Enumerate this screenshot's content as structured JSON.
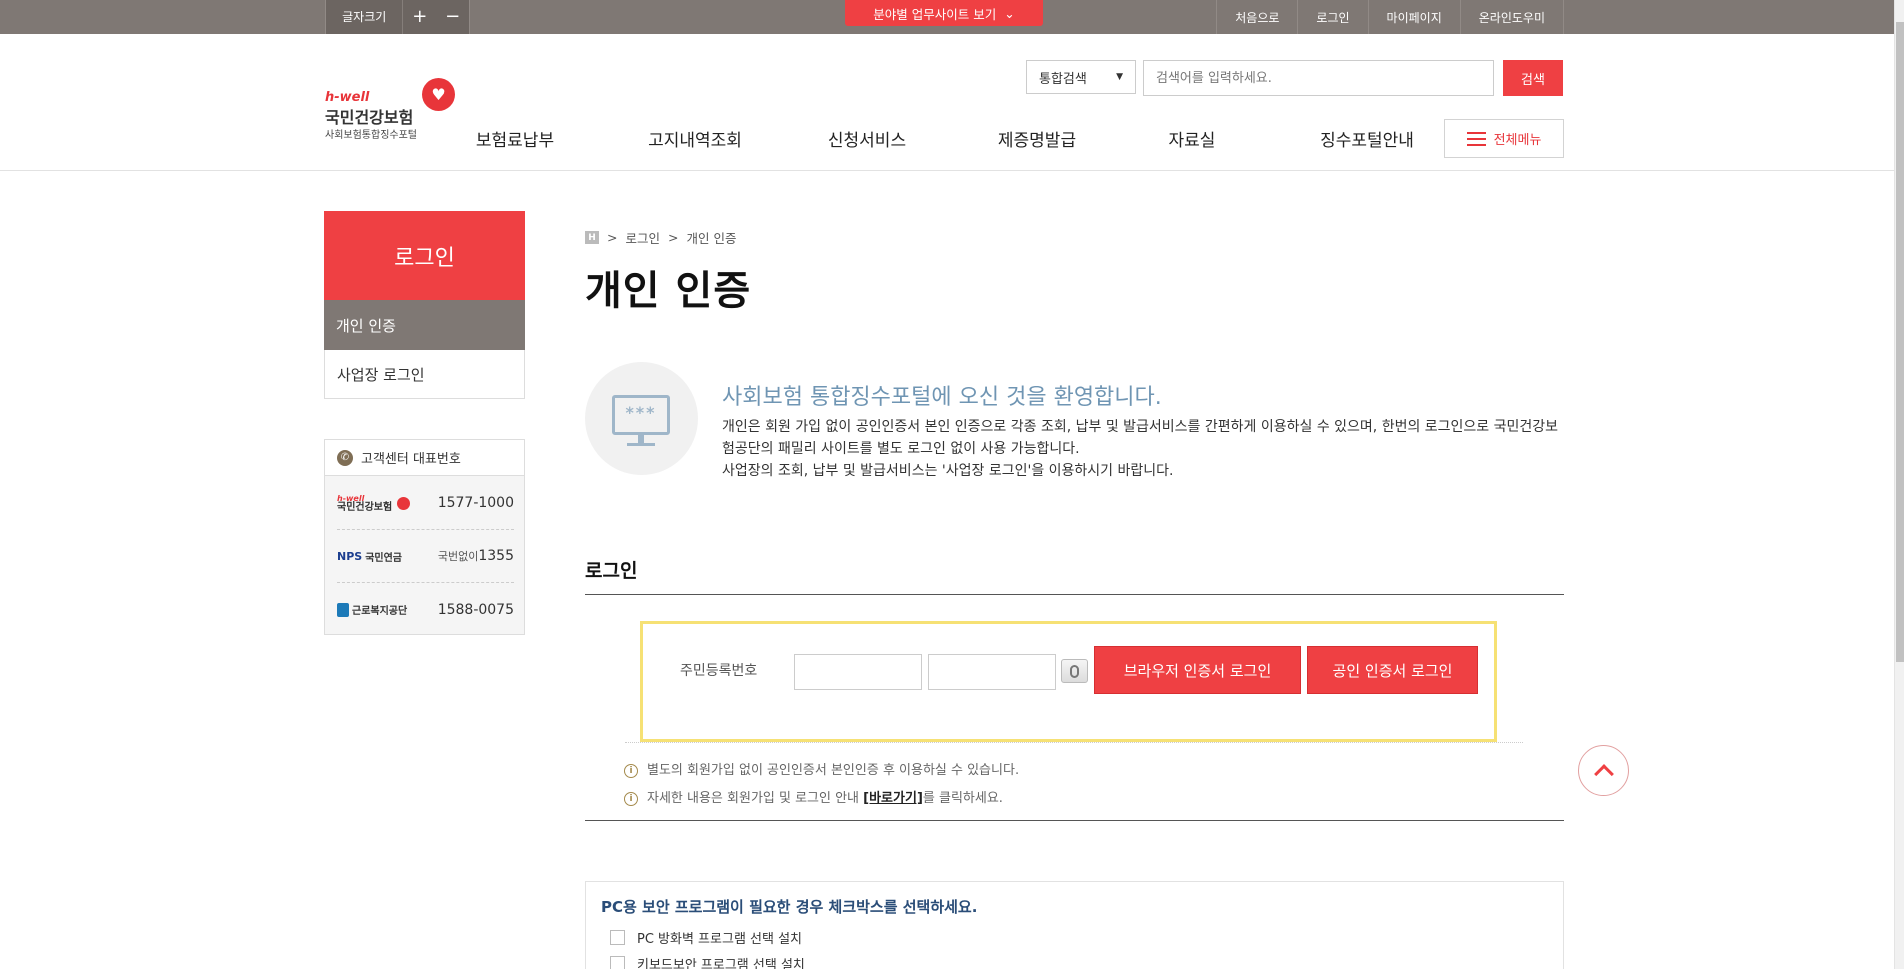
{
  "topbar": {
    "font_size_label": "글자크기",
    "font_plus": "+",
    "font_minus": "−",
    "field_site_label": "분야별 업무사이트 보기",
    "field_site_icon": "chevron-down-icon",
    "links": [
      "처음으로",
      "로그인",
      "마이페이지",
      "온라인도우미"
    ]
  },
  "header": {
    "logo": {
      "hwell": "h-well",
      "name": "국민건강보험",
      "sub": "사회보험통합징수포털"
    },
    "search": {
      "select_value": "통합검색",
      "placeholder": "검색어를 입력하세요.",
      "button": "검색"
    },
    "gnb": [
      "보험료납부",
      "고지내역조회",
      "신청서비스",
      "제증명발급",
      "자료실",
      "징수포털안내"
    ],
    "all_menu": "전체메뉴"
  },
  "sidebar": {
    "title": "로그인",
    "items": [
      {
        "label": "개인 인증",
        "active": true
      },
      {
        "label": "사업장 로그인",
        "active": false
      }
    ],
    "customer_center": {
      "title": "고객센터 대표번호",
      "rows": [
        {
          "org": "국민건강보험",
          "org_tag": "h-well",
          "number": "1577-1000",
          "prefix": ""
        },
        {
          "org": "국민연금",
          "org_tag": "NPS",
          "number": "1355",
          "prefix": "국번없이"
        },
        {
          "org": "근로복지공단",
          "org_tag": "",
          "number": "1588-0075",
          "prefix": ""
        }
      ]
    }
  },
  "main": {
    "breadcrumb": [
      "H",
      ">",
      "로그인",
      ">",
      "개인 인증"
    ],
    "title": "개인 인증",
    "welcome": {
      "title": "사회보험 통합징수포털에 오신 것을 환영합니다.",
      "icon_text": "***",
      "desc_1": "개인은 회원 가입 없이 공인인증서 본인 인증으로 각종 조회, 납부 및 발급서비스를 간편하게 이용하실 수 있으며, 한번의 로그인으로 국민건강보험공단의 패밀리 사이트를 별도 로그인 없이 사용 가능합니다.",
      "desc_2": "사업장의 조회, 납부 및 발급서비스는 '사업장 로그인'을 이용하시기 바랍니다."
    },
    "login": {
      "heading": "로그인",
      "rrn_label": "주민등록번호",
      "rrn_front": "",
      "rrn_back": "",
      "browser_cert_button": "브라우저 인증서 로그인",
      "public_cert_button": "공인 인증서 로그인",
      "note_1": "별도의 회원가입 없이 공인인증서 본인인증 후 이용하실 수 있습니다.",
      "note_2_before": "자세한 내용은 회원가입 및 로그인 안내 ",
      "note_2_link": "[바로가기]",
      "note_2_after": "를 클릭하세요."
    },
    "security": {
      "title": "PC용 보안 프로그램이 필요한 경우 체크박스를 선택하세요.",
      "options": [
        "PC 방화벽 프로그램 선택 설치",
        "키보드보안 프로그램 선택 설치"
      ]
    }
  },
  "colors": {
    "brand_red": "#ef4043",
    "topbar_gray": "#7f7874",
    "welcome_blue": "#6f95b3",
    "highlight_yellow": "#f6e174"
  }
}
